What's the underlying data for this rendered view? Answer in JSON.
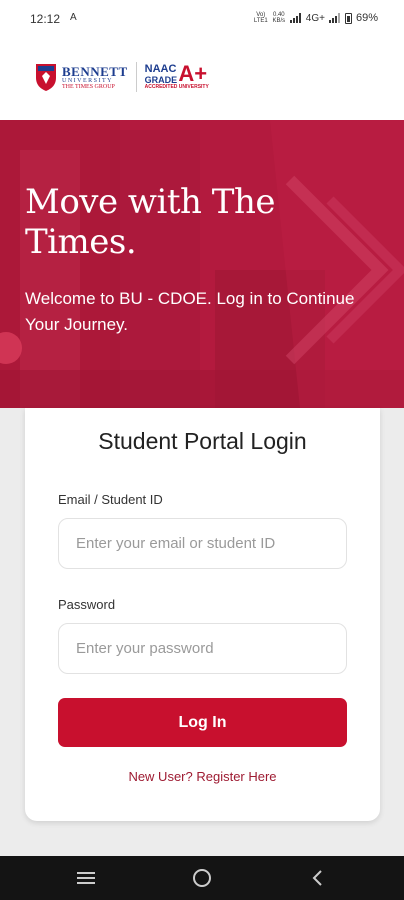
{
  "status_bar": {
    "time": "12:12",
    "nav_glyph": "A",
    "volte": "Vo) LTE1",
    "speed": "0.40 KB/s",
    "network": "4G+",
    "battery": "69%"
  },
  "header": {
    "university_name": "BENNETT",
    "university_sub": "UNIVERSITY",
    "group": "THE TIMES GROUP",
    "naac": "NAAC",
    "grade": "GRADE",
    "grade_value": "A+",
    "accredited": "ACCREDITED UNIVERSITY"
  },
  "hero": {
    "title": "Move with The Times.",
    "subtitle": "Welcome to BU - CDOE. Log in to Continue Your Journey."
  },
  "login": {
    "title": "Student Portal Login",
    "email_label": "Email / Student ID",
    "email_placeholder": "Enter your email or student ID",
    "email_value": "",
    "password_label": "Password",
    "password_placeholder": "Enter your password",
    "password_value": "",
    "login_button": "Log In",
    "register_link": "New User? Register Here"
  },
  "colors": {
    "brand_red": "#c8102e",
    "hero_red": "#b51b3f",
    "brand_blue": "#1d3d8f"
  },
  "icons": [
    "shield-logo-icon",
    "menu-icon",
    "home-circle-icon",
    "back-chevron-icon",
    "signal-icon",
    "battery-icon"
  ]
}
